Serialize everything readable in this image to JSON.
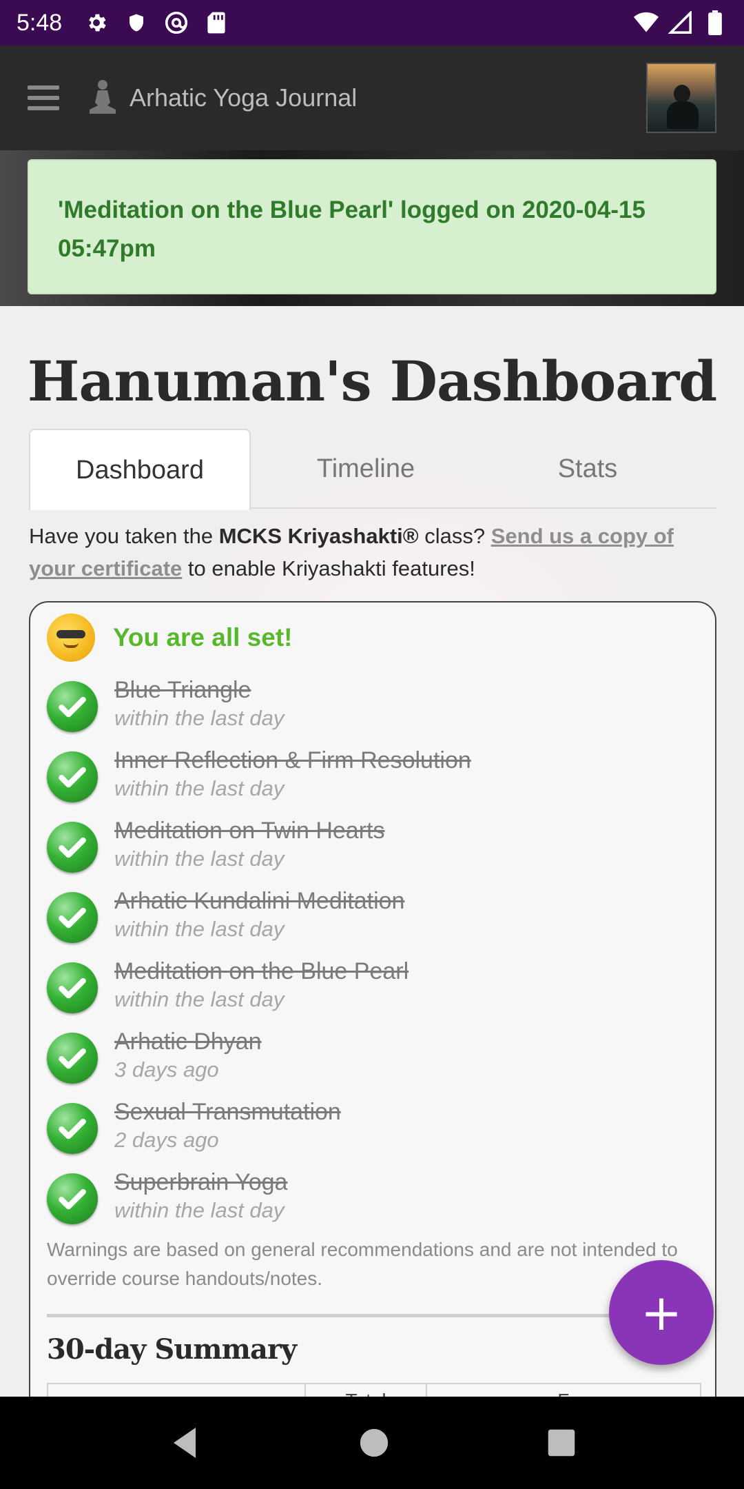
{
  "status_bar": {
    "time": "5:48",
    "left_icons": [
      "gear-icon",
      "shield-icon",
      "at-sign-icon",
      "sd-card-icon"
    ],
    "right_icons": [
      "wifi-icon",
      "cell-signal-icon",
      "battery-icon"
    ]
  },
  "app_bar": {
    "title": "Arhatic Yoga Journal"
  },
  "alert": {
    "message": "'Meditation on the Blue Pearl' logged on 2020-04-15 05:47pm"
  },
  "page": {
    "title": "Hanuman's Dashboard"
  },
  "tabs": [
    {
      "label": "Dashboard",
      "active": true
    },
    {
      "label": "Timeline",
      "active": false
    },
    {
      "label": "Stats",
      "active": false
    }
  ],
  "notice": {
    "prefix": "Have you taken the ",
    "class_name": "MCKS Kriyashakti®",
    "middle": " class? ",
    "link_text": "Send us a copy of your certificate",
    "suffix": " to enable Kriyashakti features!"
  },
  "checklist": {
    "status_text": "You are all set!",
    "items": [
      {
        "name": "Blue Triangle",
        "when": "within the last day"
      },
      {
        "name": "Inner Reflection & Firm Resolution",
        "when": "within the last day"
      },
      {
        "name": "Meditation on Twin Hearts",
        "when": "within the last day"
      },
      {
        "name": "Arhatic Kundalini Meditation",
        "when": "within the last day"
      },
      {
        "name": "Meditation on the Blue Pearl",
        "when": "within the last day"
      },
      {
        "name": "Arhatic Dhyan",
        "when": "3 days ago"
      },
      {
        "name": "Sexual Transmutation",
        "when": "2 days ago"
      },
      {
        "name": "Superbrain Yoga",
        "when": "within the last day"
      }
    ],
    "warning": "Warnings are based on general recommendations and are not intended to override course handouts/notes."
  },
  "summary": {
    "title": "30-day Summary",
    "columns": [
      "",
      "Total",
      "F"
    ]
  },
  "fab": {
    "label": "+"
  },
  "colors": {
    "status_bar": "#3a0a52",
    "app_bar": "#2a2a2a",
    "alert_bg": "#d6efcf",
    "alert_text": "#2f7a2b",
    "all_set": "#58b82b",
    "fab": "#8a35b8"
  }
}
